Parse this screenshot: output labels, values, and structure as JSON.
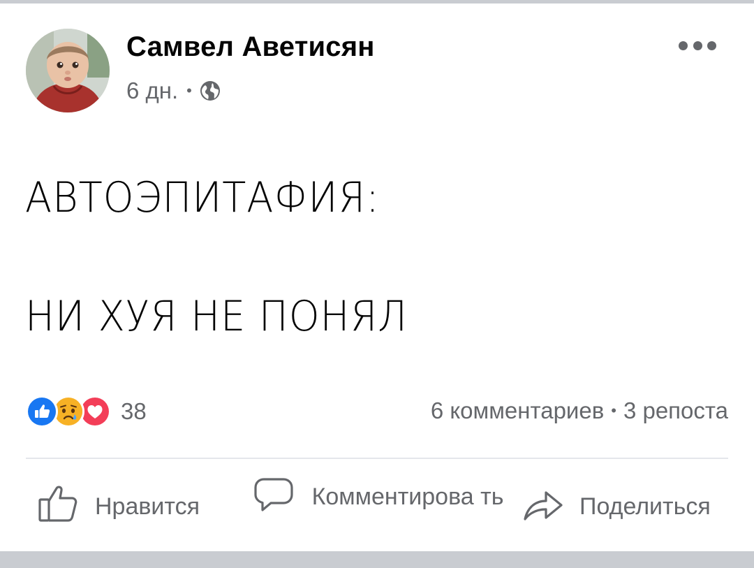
{
  "post": {
    "author": "Самвел Аветисян",
    "time": "6 дн.",
    "separator": "•",
    "privacy_icon": "globe-icon",
    "text_lines": [
      "АВТОЭПИТАФИЯ:",
      "НИ ХУЯ НЕ ПОНЯЛ"
    ]
  },
  "reactions": {
    "icons": [
      "like-reaction-icon",
      "sad-reaction-icon",
      "love-reaction-icon"
    ],
    "count": "38"
  },
  "stats": {
    "comments": "6 комментариев",
    "separator": "•",
    "shares": "3 репоста"
  },
  "actions": {
    "like": "Нравится",
    "comment": "Комментирова ть",
    "share": "Поделиться"
  },
  "colors": {
    "like_blue": "#1877f2",
    "love_red": "#f33e58",
    "sad_yellow": "#f7b125",
    "secondary_text": "#65676b"
  }
}
